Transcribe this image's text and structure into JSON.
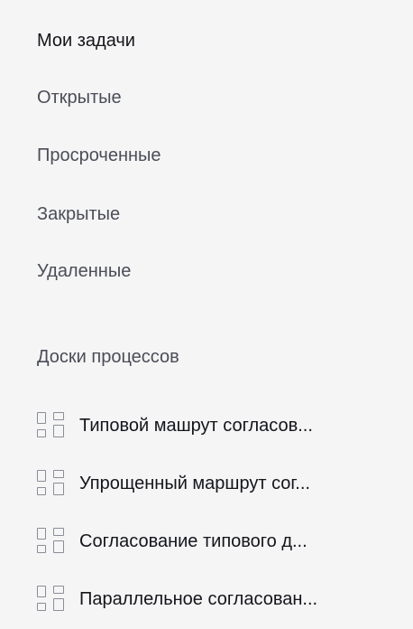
{
  "tasks_nav": {
    "items": [
      {
        "label": "Мои задачи",
        "active": true
      },
      {
        "label": "Открытые",
        "active": false
      },
      {
        "label": "Просроченные",
        "active": false
      },
      {
        "label": "Закрытые",
        "active": false
      },
      {
        "label": "Удаленные",
        "active": false
      }
    ]
  },
  "boards": {
    "title": "Доски процессов",
    "items": [
      {
        "label": "Типовой машрут согласов...",
        "icon": "board-grid-icon"
      },
      {
        "label": "Упрощенный маршрут сог...",
        "icon": "board-grid-icon"
      },
      {
        "label": "Согласование типового д...",
        "icon": "board-grid-icon"
      },
      {
        "label": "Параллельное согласован...",
        "icon": "board-grid-icon"
      }
    ]
  },
  "colors": {
    "background": "#f5f5f6",
    "text_primary": "#14151a",
    "text_secondary": "#4b4d57",
    "icon": "#8b8d96"
  }
}
